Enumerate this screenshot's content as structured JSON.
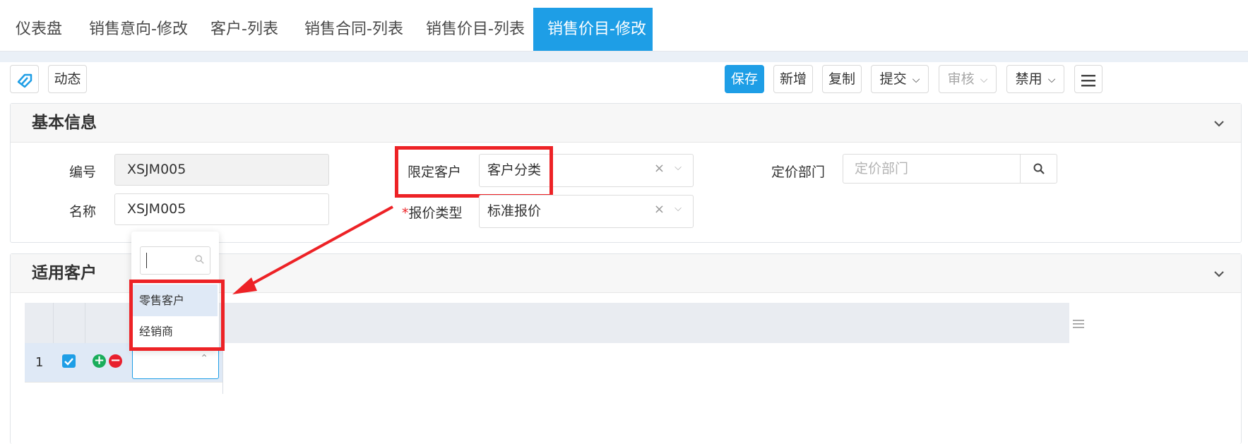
{
  "tabs": [
    {
      "label": "仪表盘"
    },
    {
      "label": "销售意向-修改"
    },
    {
      "label": "客户-列表"
    },
    {
      "label": "销售合同-列表"
    },
    {
      "label": "销售价目-列表"
    },
    {
      "label": "销售价目-修改",
      "active": true
    }
  ],
  "toolbar": {
    "dynamic_label": "动态",
    "save_label": "保存",
    "new_label": "新增",
    "copy_label": "复制",
    "submit_label": "提交",
    "audit_label": "审核",
    "disable_label": "禁用",
    "caret": "⌵"
  },
  "basic_info": {
    "title": "基本信息",
    "code_label": "编号",
    "code_value": "XSJM005",
    "name_label": "名称",
    "name_value": "XSJM005",
    "limit_customer_label": "限定客户",
    "limit_customer_value": "客户分类",
    "quote_type_required": "*",
    "quote_type_label": "报价类型",
    "quote_type_value": "标准报价",
    "pricing_dept_label": "定价部门",
    "pricing_dept_placeholder": "定价部门"
  },
  "applicable_customers": {
    "title": "适用客户",
    "row_number": "1"
  },
  "dropdown": {
    "options": [
      "零售客户",
      "经销商"
    ],
    "highlighted_index": 0
  },
  "colors": {
    "accent": "#1e9ee6",
    "highlight_box": "#ed2226",
    "add_button": "#1aad5b",
    "remove_button": "#e8202e"
  }
}
